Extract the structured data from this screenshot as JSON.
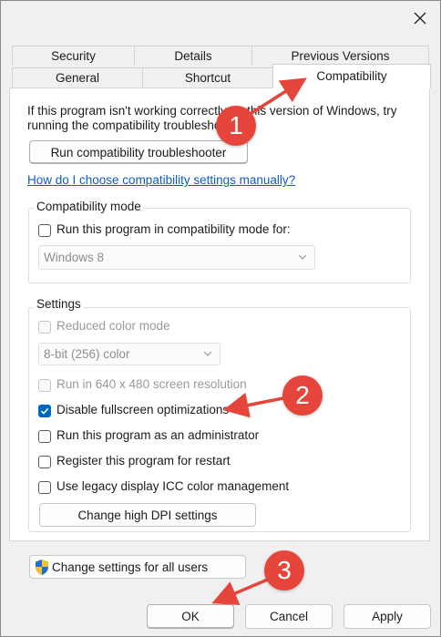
{
  "tabs": {
    "row1": [
      {
        "label": "Security"
      },
      {
        "label": "Details"
      },
      {
        "label": "Previous Versions"
      }
    ],
    "row2": [
      {
        "label": "General"
      },
      {
        "label": "Shortcut"
      },
      {
        "label": "Compatibility"
      }
    ]
  },
  "intro": {
    "line1": "If this program isn't working correctly on this version of Windows, try",
    "line2": "running the compatibility troubleshooter."
  },
  "troubleshooter_button": "Run compatibility troubleshooter",
  "help_link": "How do I choose compatibility settings manually?",
  "compat_mode": {
    "group_label": "Compatibility mode",
    "checkbox_label": "Run this program in compatibility mode for:",
    "checked": false,
    "os_selected": "Windows 8"
  },
  "settings": {
    "group_label": "Settings",
    "reduced_color": "Reduced color mode",
    "color_depth": "8-bit (256) color",
    "run_640": "Run in 640 x 480 screen resolution",
    "disable_fullscreen": "Disable fullscreen optimizations",
    "run_admin": "Run this program as an administrator",
    "register_restart": "Register this program for restart",
    "legacy_icc": "Use legacy display ICC color management",
    "dpi_button": "Change high DPI settings"
  },
  "all_users_button": "Change settings for all users",
  "footer": {
    "ok": "OK",
    "cancel": "Cancel",
    "apply": "Apply"
  },
  "annotations": [
    "1",
    "2",
    "3"
  ],
  "colors": {
    "accent": "#0067c0",
    "link": "#0b5cc8",
    "annotation": "#e5453a"
  }
}
